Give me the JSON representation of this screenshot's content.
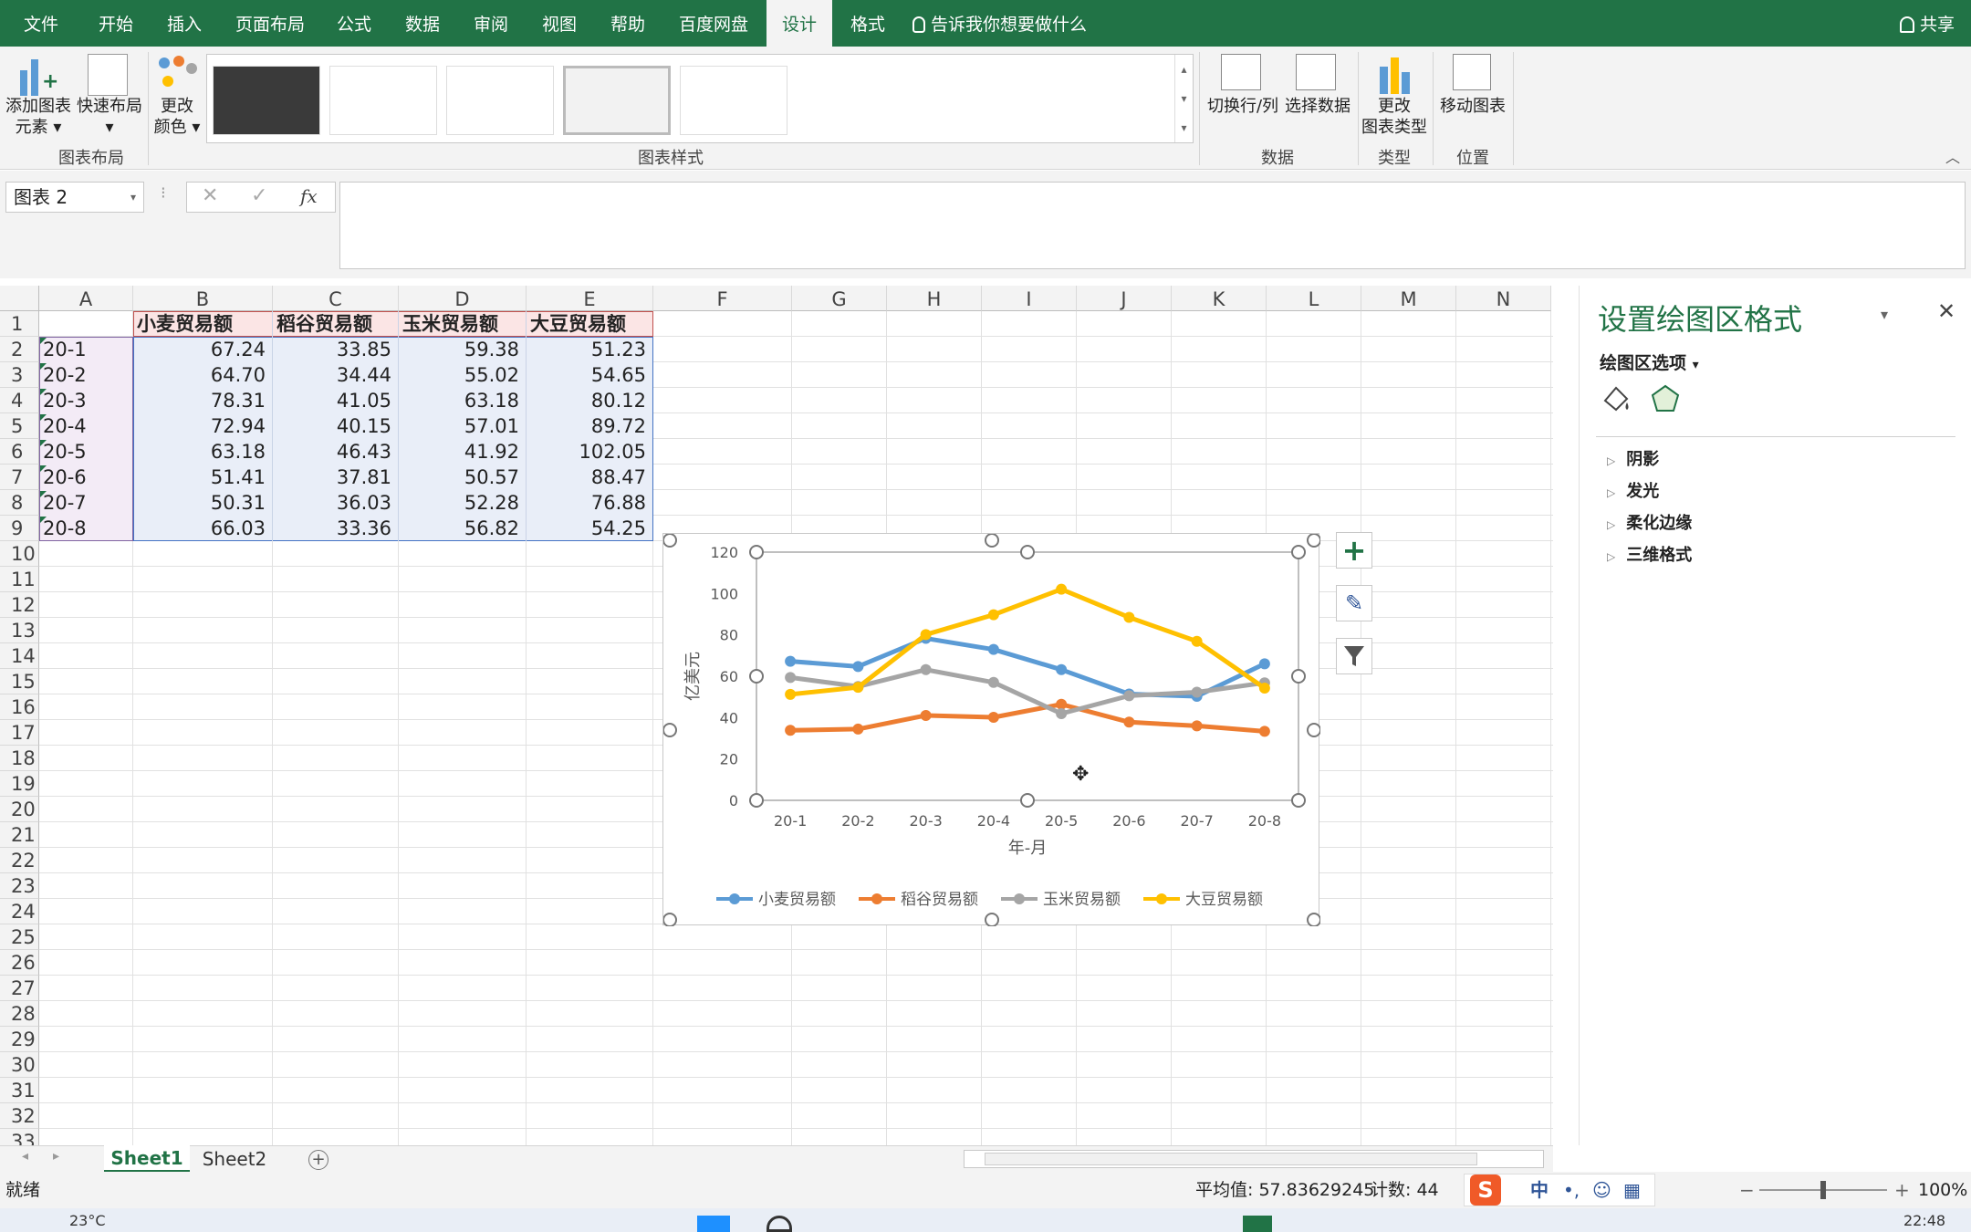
{
  "ribbon_tabs": [
    "文件",
    "开始",
    "插入",
    "页面布局",
    "公式",
    "数据",
    "审阅",
    "视图",
    "帮助",
    "百度网盘",
    "设计",
    "格式"
  ],
  "active_tab": "设计",
  "tell_me": "告诉我你想要做什么",
  "share": "共享",
  "ribbon": {
    "add_element": [
      "添加图表",
      "元素"
    ],
    "quick_layout": "快速布局",
    "change_color": [
      "更改",
      "颜色"
    ],
    "group_chart_layout": "图表布局",
    "group_chart_styles": "图表样式",
    "switch_row_col": "切换行/列",
    "select_data": "选择数据",
    "group_data": "数据",
    "change_type": [
      "更改",
      "图表类型"
    ],
    "group_type": "类型",
    "move_chart": "移动图表",
    "group_location": "位置"
  },
  "name_box": "图表 2",
  "fx": "fx",
  "columns": [
    "A",
    "B",
    "C",
    "D",
    "E",
    "F",
    "G",
    "H",
    "I",
    "J",
    "K",
    "L",
    "M",
    "N"
  ],
  "rows": [
    "1",
    "2",
    "3",
    "4",
    "5",
    "6",
    "7",
    "8",
    "9",
    "10",
    "11",
    "12",
    "13",
    "14",
    "15",
    "16",
    "17",
    "18",
    "19",
    "20",
    "21",
    "22",
    "23",
    "24",
    "25",
    "26",
    "27",
    "28",
    "29",
    "30",
    "31",
    "32",
    "33"
  ],
  "table": {
    "headers": [
      "小麦贸易额",
      "稻谷贸易额",
      "玉米贸易额",
      "大豆贸易额"
    ],
    "labels": [
      "20-1",
      "20-2",
      "20-3",
      "20-4",
      "20-5",
      "20-6",
      "20-7",
      "20-8"
    ],
    "rows": [
      [
        "67.24",
        "33.85",
        "59.38",
        "51.23"
      ],
      [
        "64.70",
        "34.44",
        "55.02",
        "54.65"
      ],
      [
        "78.31",
        "41.05",
        "63.18",
        "80.12"
      ],
      [
        "72.94",
        "40.15",
        "57.01",
        "89.72"
      ],
      [
        "63.18",
        "46.43",
        "41.92",
        "102.05"
      ],
      [
        "51.41",
        "37.81",
        "50.57",
        "88.47"
      ],
      [
        "50.31",
        "36.03",
        "52.28",
        "76.88"
      ],
      [
        "66.03",
        "33.36",
        "56.82",
        "54.25"
      ]
    ]
  },
  "chart_data": {
    "type": "line",
    "categories": [
      "20-1",
      "20-2",
      "20-3",
      "20-4",
      "20-5",
      "20-6",
      "20-7",
      "20-8"
    ],
    "series": [
      {
        "name": "小麦贸易额",
        "color": "#5b9bd5",
        "values": [
          67.24,
          64.7,
          78.31,
          72.94,
          63.18,
          51.41,
          50.31,
          66.03
        ]
      },
      {
        "name": "稻谷贸易额",
        "color": "#ed7d31",
        "values": [
          33.85,
          34.44,
          41.05,
          40.15,
          46.43,
          37.81,
          36.03,
          33.36
        ]
      },
      {
        "name": "玉米贸易额",
        "color": "#a5a5a5",
        "values": [
          59.38,
          55.02,
          63.18,
          57.01,
          41.92,
          50.57,
          52.28,
          56.82
        ]
      },
      {
        "name": "大豆贸易额",
        "color": "#ffc000",
        "values": [
          51.23,
          54.65,
          80.12,
          89.72,
          102.05,
          88.47,
          76.88,
          54.25
        ]
      }
    ],
    "yticks": [
      0,
      20,
      40,
      60,
      80,
      100,
      120
    ],
    "ylim": [
      0,
      120
    ],
    "xlabel": "年-月",
    "ylabel": "亿美元",
    "legend": "bottom",
    "grid": false
  },
  "pane": {
    "title": "设置绘图区格式",
    "subtitle": "绘图区选项",
    "sections": [
      "阴影",
      "发光",
      "柔化边缘",
      "三维格式"
    ]
  },
  "sheets": [
    "Sheet1",
    "Sheet2"
  ],
  "status": {
    "ready": "就绪",
    "average": "平均值: 57.83629245",
    "count": "计数: 44",
    "zoom": "100%"
  },
  "taskbar": {
    "temp": "23°C",
    "time": "22:48"
  },
  "colors": {
    "excel_green": "#217346"
  }
}
